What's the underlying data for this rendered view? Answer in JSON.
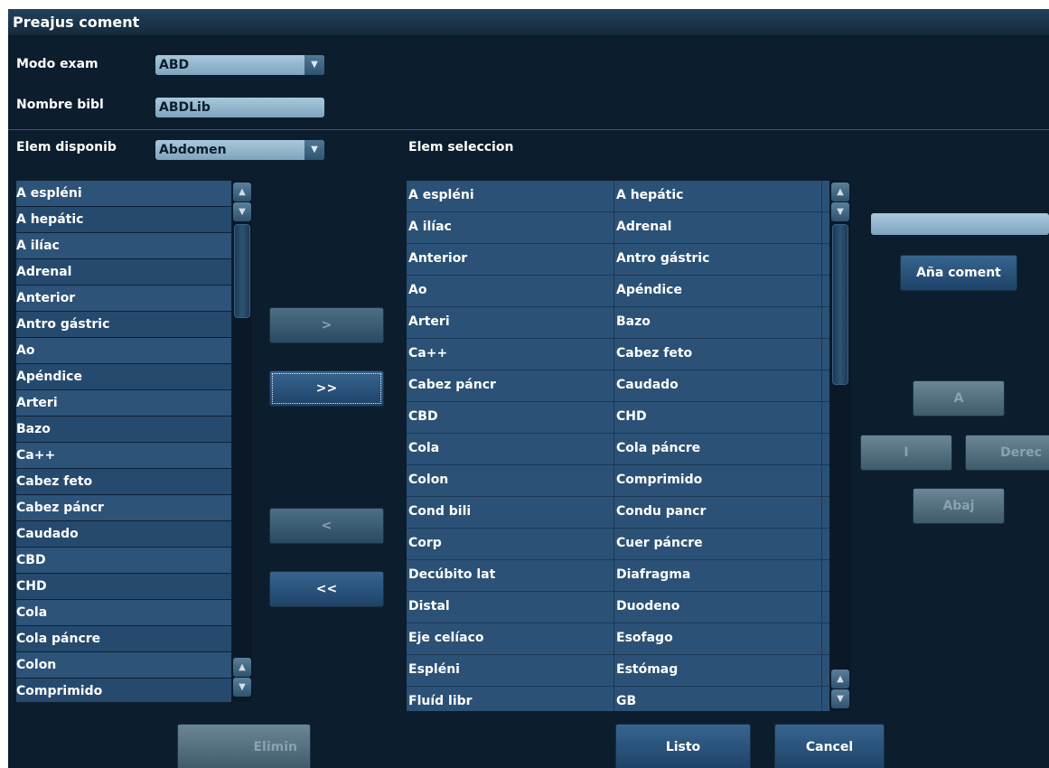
{
  "title": "Preajus coment",
  "exam_mode": {
    "label": "Modo exam",
    "value": "ABD"
  },
  "library": {
    "label": "Nombre bibl",
    "value": "ABDLib"
  },
  "available": {
    "label": "Elem disponib",
    "category": "Abdomen",
    "items": [
      "A espléni",
      "A hepátic",
      "A ilíac",
      "Adrenal",
      "Anterior",
      "Antro gástric",
      "Ao",
      "Apéndice",
      "Arteri",
      "Bazo",
      "Ca++",
      "Cabez feto",
      "Cabez páncr",
      "Caudado",
      "CBD",
      "CHD",
      "Cola",
      "Cola páncre",
      "Colon",
      "Comprimido"
    ]
  },
  "selected": {
    "label": "Elem seleccion",
    "rows": [
      [
        "A espléni",
        "A hepátic"
      ],
      [
        "A ilíac",
        "Adrenal"
      ],
      [
        "Anterior",
        "Antro gástric"
      ],
      [
        "Ao",
        "Apéndice"
      ],
      [
        "Arteri",
        "Bazo"
      ],
      [
        "Ca++",
        "Cabez feto"
      ],
      [
        "Cabez páncr",
        "Caudado"
      ],
      [
        "CBD",
        "CHD"
      ],
      [
        "Cola",
        "Cola páncre"
      ],
      [
        "Colon",
        "Comprimido"
      ],
      [
        "Cond bili",
        "Condu pancr"
      ],
      [
        "Corp",
        "Cuer páncre"
      ],
      [
        "Decúbito lat",
        "Diafragma"
      ],
      [
        "Distal",
        "Duodeno"
      ],
      [
        "Eje celíaco",
        "Esofago"
      ],
      [
        "Espléni",
        "Estómag"
      ],
      [
        "Fluíd libr",
        "GB"
      ]
    ]
  },
  "transfer": {
    "add_one": ">",
    "add_all": ">>",
    "remove_one": "<",
    "remove_all": "<<"
  },
  "comment": {
    "input_value": "",
    "add_label": "Aña coment"
  },
  "move": {
    "up": "A",
    "left": "I",
    "right": "Derec",
    "down": "Abaj"
  },
  "footer": {
    "delete": "Elimin",
    "done": "Listo",
    "cancel": "Cancel"
  },
  "icons": {
    "up": "triangle-up",
    "down": "triangle-down"
  }
}
